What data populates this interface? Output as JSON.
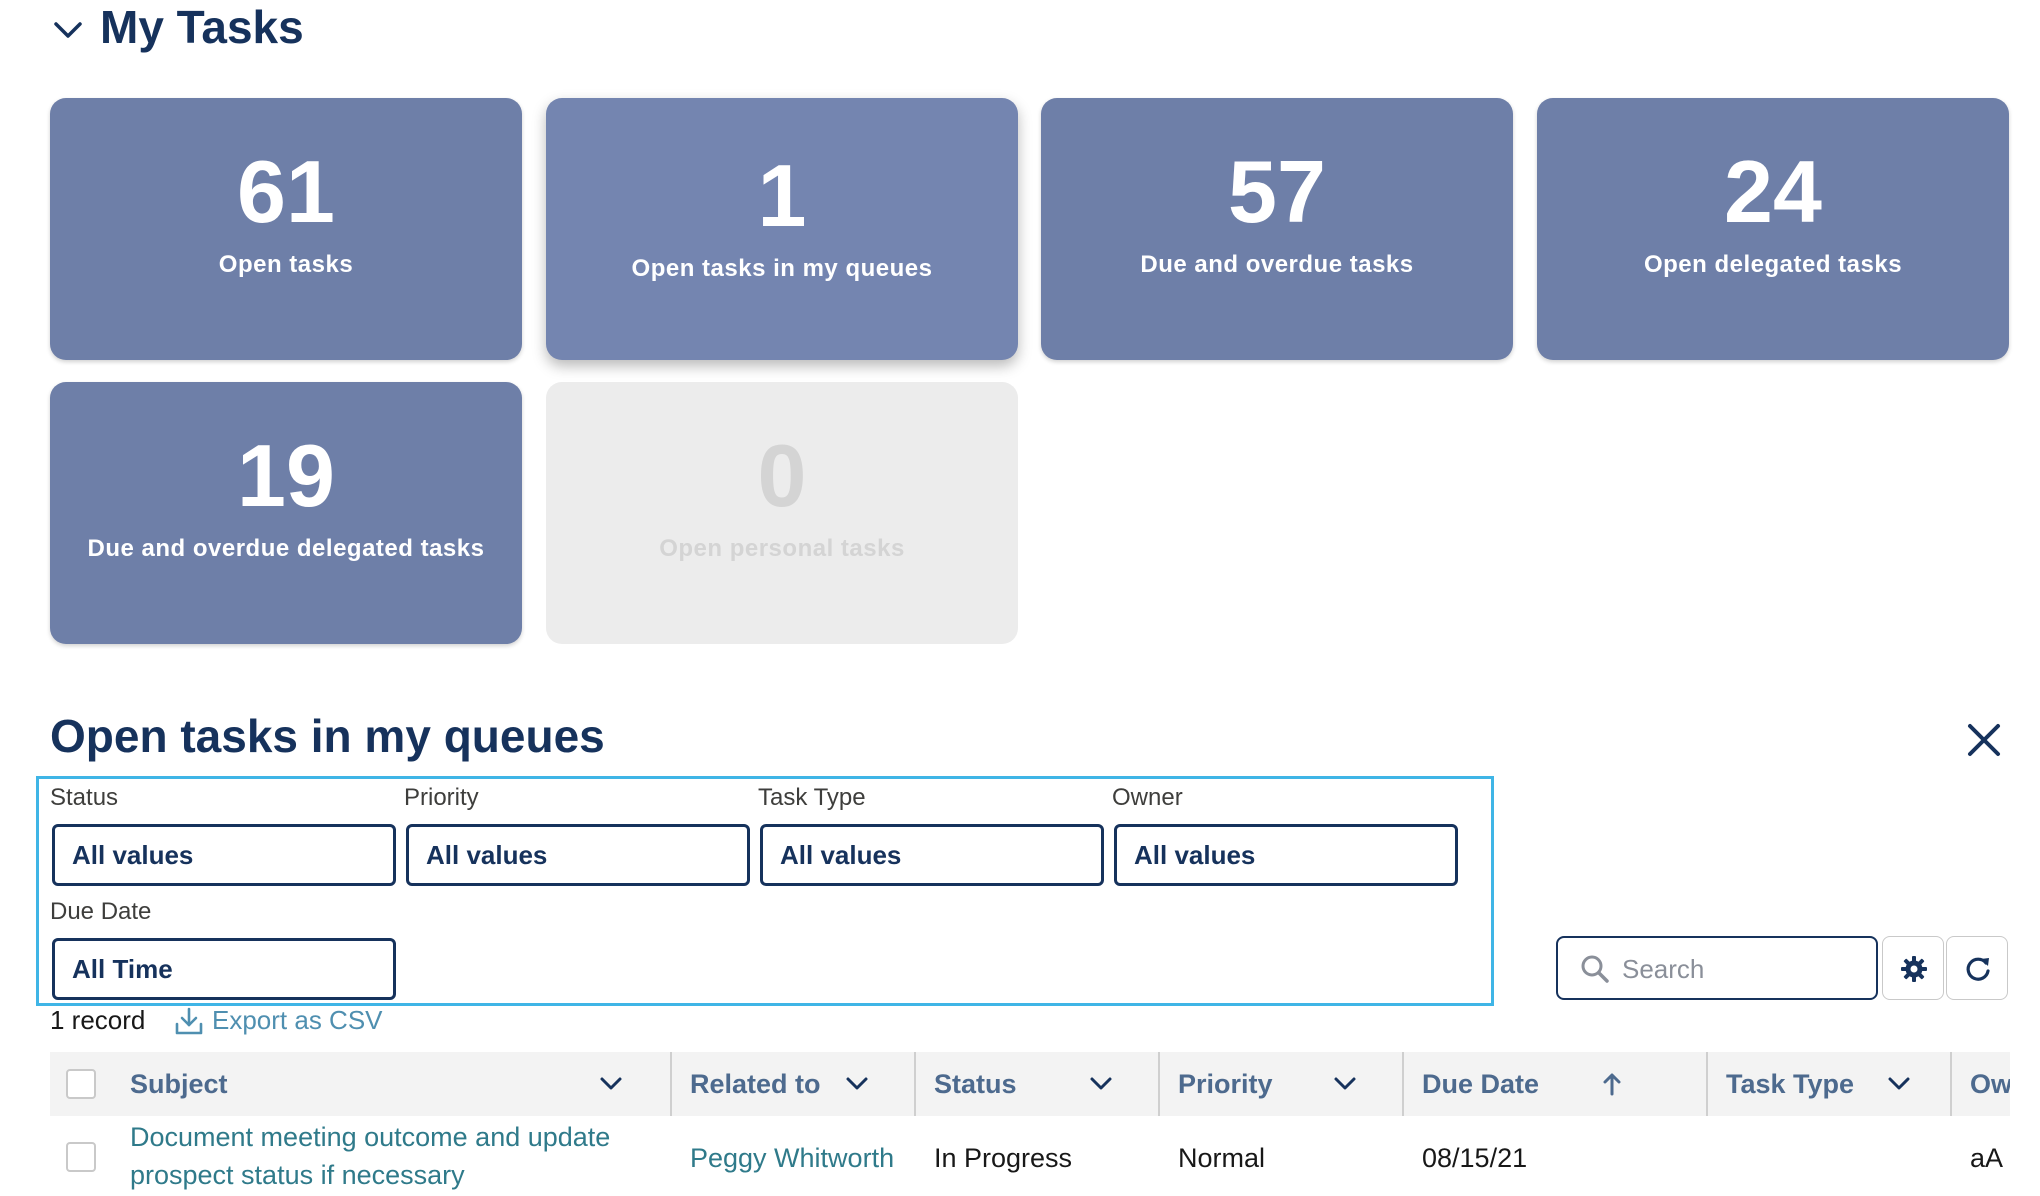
{
  "header": {
    "title": "My Tasks",
    "collapse_icon": "chevron-down-icon"
  },
  "stats": [
    {
      "value": "61",
      "label": "Open tasks"
    },
    {
      "value": "1",
      "label": "Open tasks in my queues",
      "state": "selected"
    },
    {
      "value": "57",
      "label": "Due and overdue tasks"
    },
    {
      "value": "24",
      "label": "Open delegated tasks"
    },
    {
      "value": "19",
      "label": "Due and overdue delegated tasks"
    },
    {
      "value": "0",
      "label": "Open personal tasks",
      "state": "disabled"
    }
  ],
  "section": {
    "title": "Open tasks in my queues",
    "close_icon": "close-icon"
  },
  "filters": {
    "status": {
      "label": "Status",
      "value": "All values"
    },
    "priority": {
      "label": "Priority",
      "value": "All values"
    },
    "task_type": {
      "label": "Task Type",
      "value": "All values"
    },
    "owner": {
      "label": "Owner",
      "value": "All values"
    },
    "due_date": {
      "label": "Due Date",
      "value": "All Time"
    }
  },
  "search": {
    "placeholder": "Search",
    "icon": "search-icon"
  },
  "toolbar": {
    "settings_icon": "gear-icon",
    "refresh_icon": "refresh-icon"
  },
  "records": {
    "count": "1 record",
    "export_label": "Export as CSV",
    "export_icon": "download-icon"
  },
  "table": {
    "columns": [
      "Subject",
      "Related to",
      "Status",
      "Priority",
      "Due Date",
      "Task Type",
      "Owner"
    ],
    "sort_icon": "arrow-up-icon",
    "rows": [
      {
        "subject_line1": "Document meeting outcome and update",
        "subject_line2": "prospect status if necessary",
        "related_to": "Peggy Whitworth",
        "status": "In Progress",
        "priority": "Normal",
        "due_date": "08/15/21",
        "task_type": "",
        "owner": "aA"
      }
    ]
  },
  "colors": {
    "card": "#6e7fa8",
    "card_disabled": "#ececec",
    "heading": "#16325c",
    "highlight_border": "#3fb5e6",
    "link": "#2f7a8a"
  }
}
